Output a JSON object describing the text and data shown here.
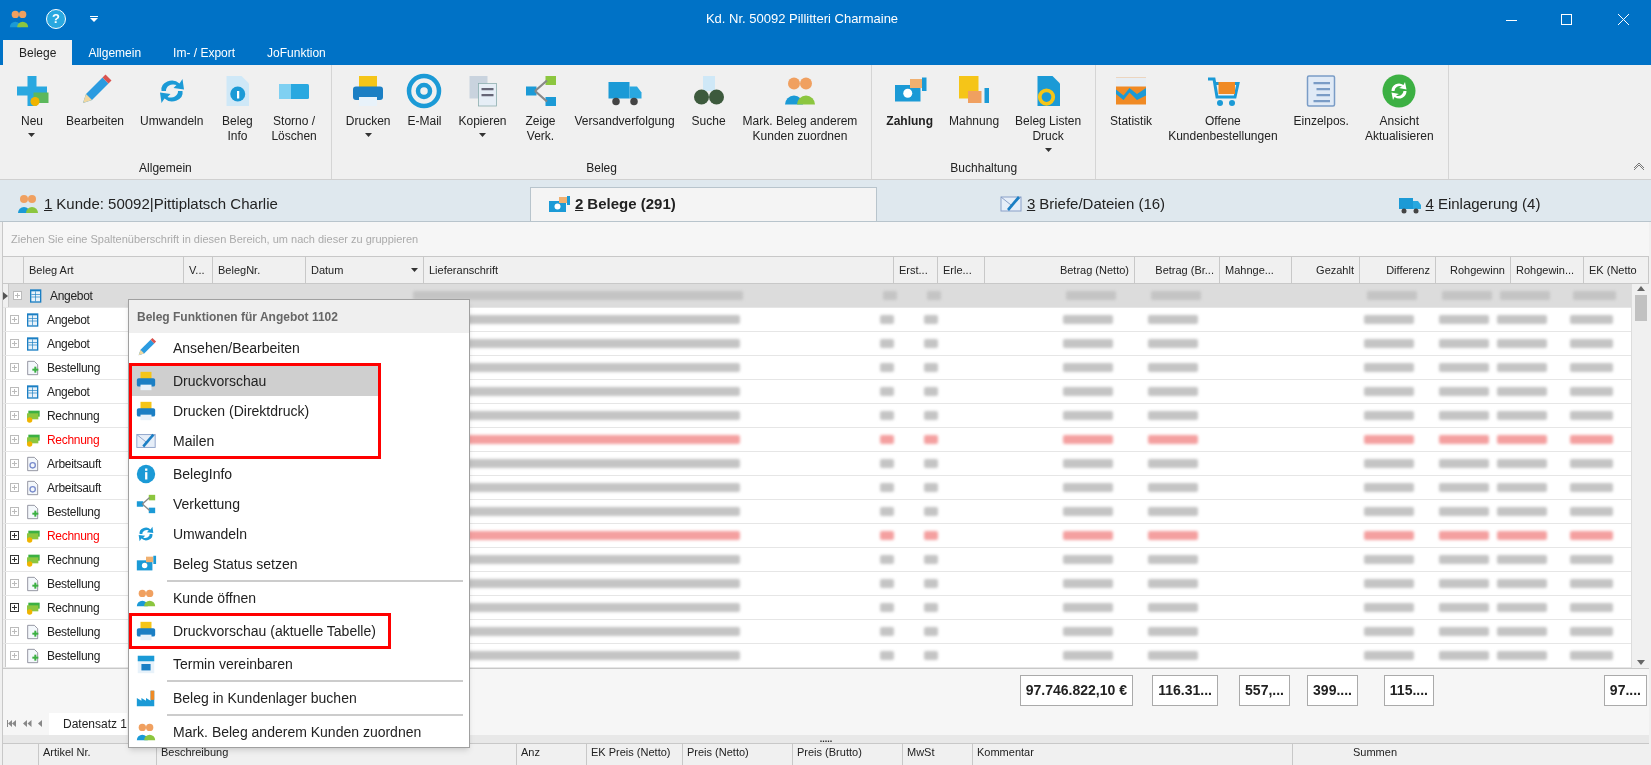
{
  "window": {
    "title": "Kd. Nr. 50092 Pillitteri Charmaine",
    "help": "?"
  },
  "ribbon_tabs": [
    {
      "label": "Belege",
      "selected": true
    },
    {
      "label": "Allgemein",
      "selected": false
    },
    {
      "label": "Im- / Export",
      "selected": false
    },
    {
      "label": "JoFunktion",
      "selected": false
    }
  ],
  "ribbon_groups": [
    {
      "label": "Allgemein",
      "buttons": [
        {
          "label": "Neu",
          "dropdown": true,
          "bold": false
        },
        {
          "label": "Bearbeiten",
          "dropdown": false,
          "bold": false
        },
        {
          "label": "Umwandeln",
          "dropdown": false,
          "bold": false
        },
        {
          "label": "Beleg\nInfo",
          "dropdown": false,
          "bold": false
        },
        {
          "label": "Storno /\nLöschen",
          "dropdown": false,
          "bold": false
        }
      ]
    },
    {
      "label": "Beleg",
      "buttons": [
        {
          "label": "Drucken",
          "dropdown": true,
          "bold": false
        },
        {
          "label": "E-Mail",
          "dropdown": false,
          "bold": false
        },
        {
          "label": "Kopieren",
          "dropdown": true,
          "bold": false
        },
        {
          "label": "Zeige\nVerk.",
          "dropdown": false,
          "bold": false
        },
        {
          "label": "Versandverfolgung",
          "dropdown": false,
          "bold": false
        },
        {
          "label": "Suche",
          "dropdown": false,
          "bold": false
        },
        {
          "label": "Mark. Beleg  anderem\nKunden zuordnen",
          "dropdown": false,
          "bold": false
        }
      ]
    },
    {
      "label": "Buchhaltung",
      "buttons": [
        {
          "label": "Zahlung",
          "dropdown": false,
          "bold": true
        },
        {
          "label": "Mahnung",
          "dropdown": false,
          "bold": false
        },
        {
          "label": "Beleg Listen\nDruck",
          "dropdown": true,
          "bold": false
        }
      ]
    },
    {
      "buttons": [
        {
          "label": "Statistik",
          "dropdown": false,
          "bold": false
        },
        {
          "label": "Offene\nKundenbestellungen",
          "dropdown": false,
          "bold": false
        },
        {
          "label": "Einzelpos.",
          "dropdown": false,
          "bold": false
        },
        {
          "label": "Ansicht\nAktualisieren",
          "dropdown": false,
          "bold": false
        }
      ]
    }
  ],
  "page_tabs": [
    {
      "number": "1",
      "label": " Kunde: 50092|Pittiplatsch Charlie",
      "selected": false
    },
    {
      "number": "2",
      "label": " Belege (291)",
      "selected": true
    },
    {
      "number": "3",
      "label": " Briefe/Dateien (16)",
      "selected": false
    },
    {
      "number": "4",
      "label": " Einlagerung (4)",
      "selected": false
    }
  ],
  "group_panel": "Ziehen Sie eine Spaltenüberschrift in diesen Bereich, um nach dieser zu gruppieren",
  "columns": [
    {
      "label": "Beleg Art"
    },
    {
      "label": "V..."
    },
    {
      "label": "BelegNr."
    },
    {
      "label": "Datum"
    },
    {
      "label": "Lieferanschrift"
    },
    {
      "label": "Erst..."
    },
    {
      "label": "Erle..."
    },
    {
      "label": "Betrag (Netto)",
      "total": "97.746.822,10 €"
    },
    {
      "label": "Betrag (Br...",
      "total": "116.31..."
    },
    {
      "label": "Mahnge...",
      "total": "557,..."
    },
    {
      "label": "Gezahlt",
      "total": "399...."
    },
    {
      "label": "Differenz",
      "total": "115...."
    },
    {
      "label": "Rohgewinn"
    },
    {
      "label": "Rohgewin..."
    },
    {
      "label": "EK (Netto",
      "total": "97...."
    }
  ],
  "rows": [
    {
      "type": "Angebot",
      "kind": "offer",
      "warning": false,
      "has_children": false,
      "selected": true
    },
    {
      "type": "Angebot",
      "kind": "offer",
      "warning": false,
      "has_children": false,
      "selected": false
    },
    {
      "type": "Angebot",
      "kind": "offer",
      "warning": false,
      "has_children": false,
      "selected": false
    },
    {
      "type": "Bestellung",
      "kind": "order",
      "warning": false,
      "has_children": false,
      "selected": false
    },
    {
      "type": "Angebot",
      "kind": "offer",
      "warning": false,
      "has_children": false,
      "selected": false
    },
    {
      "type": "Rechnung",
      "kind": "invoice",
      "warning": false,
      "has_children": false,
      "selected": false
    },
    {
      "type": "Rechnung",
      "kind": "invoice",
      "warning": true,
      "has_children": false,
      "selected": false
    },
    {
      "type": "Arbeitsauft",
      "kind": "work",
      "warning": false,
      "has_children": false,
      "selected": false
    },
    {
      "type": "Arbeitsauft",
      "kind": "work",
      "warning": false,
      "has_children": false,
      "selected": false
    },
    {
      "type": "Bestellung",
      "kind": "order",
      "warning": false,
      "has_children": false,
      "selected": false
    },
    {
      "type": "Rechnung",
      "kind": "invoice",
      "warning": true,
      "has_children": true,
      "selected": false
    },
    {
      "type": "Rechnung",
      "kind": "invoice",
      "warning": false,
      "has_children": true,
      "selected": false
    },
    {
      "type": "Bestellung",
      "kind": "order",
      "warning": false,
      "has_children": false,
      "selected": false
    },
    {
      "type": "Rechnung",
      "kind": "invoice",
      "warning": false,
      "has_children": true,
      "selected": false
    },
    {
      "type": "Bestellung",
      "kind": "order",
      "warning": false,
      "has_children": false,
      "selected": false
    },
    {
      "type": "Bestellung",
      "kind": "order",
      "warning": false,
      "has_children": false,
      "selected": false
    }
  ],
  "navigator": {
    "record": "Datensatz 1"
  },
  "splitter": ".....",
  "detail_columns": [
    "Artikel Nr.",
    "Beschreibung",
    "Anz",
    "EK Preis (Netto)",
    "Preis (Netto)",
    "Preis (Brutto)",
    "MwSt",
    "Kommentar"
  ],
  "summary_label": "Summen",
  "context_menu": {
    "title": "Beleg Funktionen für Angebot 1102",
    "items": [
      {
        "label": "Ansehen/Bearbeiten",
        "selected": false,
        "framed": false,
        "divider_before": false
      },
      {
        "label": "Druckvorschau",
        "selected": true,
        "framed": true,
        "divider_before": false
      },
      {
        "label": "Drucken (Direktdruck)",
        "selected": false,
        "framed": true,
        "divider_before": false
      },
      {
        "label": "Mailen",
        "selected": false,
        "framed": true,
        "divider_before": false
      },
      {
        "label": "BelegInfo",
        "selected": false,
        "framed": false,
        "divider_before": false
      },
      {
        "label": "Verkettung",
        "selected": false,
        "framed": false,
        "divider_before": false
      },
      {
        "label": "Umwandeln",
        "selected": false,
        "framed": false,
        "divider_before": false
      },
      {
        "label": "Beleg Status setzen",
        "selected": false,
        "framed": false,
        "divider_before": false
      },
      {
        "label": "Kunde öffnen",
        "selected": false,
        "framed": false,
        "divider_before": true
      },
      {
        "label": "Druckvorschau (aktuelle Tabelle)",
        "selected": false,
        "framed": true,
        "divider_before": false
      },
      {
        "label": "Termin vereinbaren",
        "selected": false,
        "framed": false,
        "divider_before": false
      },
      {
        "label": "Beleg in Kundenlager buchen",
        "selected": false,
        "framed": false,
        "divider_before": true
      },
      {
        "label": "Mark. Beleg  anderem Kunden zuordnen",
        "selected": false,
        "framed": false,
        "divider_before": true
      }
    ]
  }
}
